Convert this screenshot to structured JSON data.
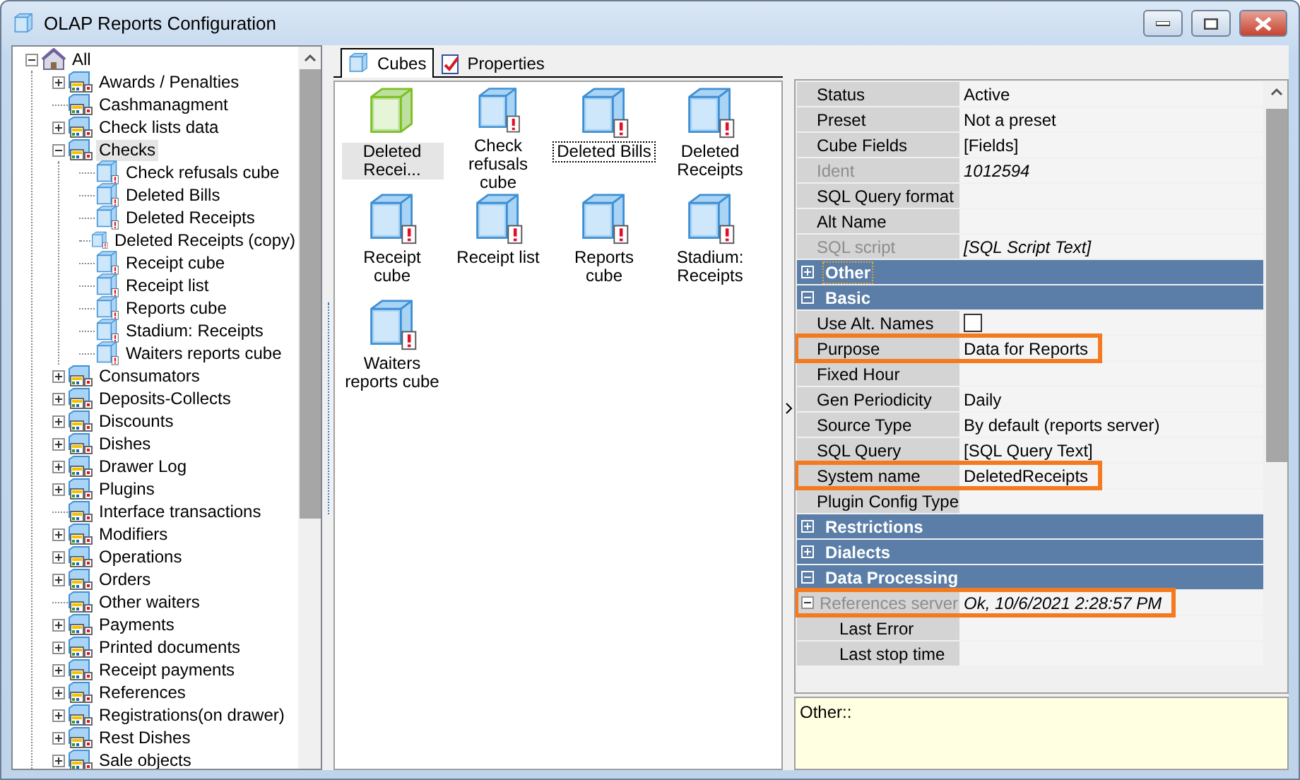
{
  "window": {
    "title": "OLAP Reports Configuration"
  },
  "tree": {
    "label": "All",
    "kind": "root",
    "expanded": true,
    "children": [
      {
        "label": "Awards / Penalties",
        "kind": "folder",
        "expanded": false,
        "selected": false
      },
      {
        "label": "Cashmanagment",
        "kind": "group",
        "selected": false
      },
      {
        "label": "Check lists data",
        "kind": "folder",
        "expanded": false,
        "selected": false
      },
      {
        "label": "Checks",
        "kind": "folder",
        "expanded": true,
        "selected": true,
        "children": [
          {
            "label": "Check refusals cube",
            "kind": "cube",
            "selected": false
          },
          {
            "label": "Deleted Bills",
            "kind": "cube",
            "selected": false
          },
          {
            "label": "Deleted Receipts",
            "kind": "cube",
            "selected": false
          },
          {
            "label": "Deleted Receipts (copy)",
            "kind": "cube",
            "selected": false
          },
          {
            "label": "Receipt cube",
            "kind": "cube",
            "selected": false
          },
          {
            "label": "Receipt list",
            "kind": "cube",
            "selected": false
          },
          {
            "label": "Reports cube",
            "kind": "cube",
            "selected": false
          },
          {
            "label": "Stadium: Receipts",
            "kind": "cube",
            "selected": false
          },
          {
            "label": "Waiters reports cube",
            "kind": "cube",
            "selected": false
          }
        ]
      },
      {
        "label": "Consumators",
        "kind": "folder",
        "expanded": false,
        "selected": false
      },
      {
        "label": "Deposits-Collects",
        "kind": "folder",
        "expanded": false,
        "selected": false
      },
      {
        "label": "Discounts",
        "kind": "folder",
        "expanded": false,
        "selected": false
      },
      {
        "label": "Dishes",
        "kind": "folder",
        "expanded": false,
        "selected": false
      },
      {
        "label": "Drawer Log",
        "kind": "folder",
        "expanded": false,
        "selected": false
      },
      {
        "label": "Plugins",
        "kind": "folder",
        "expanded": false,
        "selected": false
      },
      {
        "label": "Interface transactions",
        "kind": "group",
        "selected": false
      },
      {
        "label": "Modifiers",
        "kind": "folder",
        "expanded": false,
        "selected": false
      },
      {
        "label": "Operations",
        "kind": "folder",
        "expanded": false,
        "selected": false
      },
      {
        "label": "Orders",
        "kind": "folder",
        "expanded": false,
        "selected": false
      },
      {
        "label": "Other waiters",
        "kind": "group",
        "selected": false
      },
      {
        "label": "Payments",
        "kind": "folder",
        "expanded": false,
        "selected": false
      },
      {
        "label": "Printed documents",
        "kind": "folder",
        "expanded": false,
        "selected": false
      },
      {
        "label": "Receipt payments",
        "kind": "folder",
        "expanded": false,
        "selected": false
      },
      {
        "label": "References",
        "kind": "folder",
        "expanded": false,
        "selected": false
      },
      {
        "label": "Registrations(on drawer)",
        "kind": "folder",
        "expanded": false,
        "selected": false
      },
      {
        "label": "Rest Dishes",
        "kind": "folder",
        "expanded": false,
        "selected": false
      },
      {
        "label": "Sale objects",
        "kind": "folder",
        "expanded": false,
        "selected": false
      }
    ]
  },
  "tabs": [
    {
      "label": "Cubes",
      "kind": "cubes",
      "selected": true
    },
    {
      "label": "Properties",
      "kind": "properties",
      "selected": false
    }
  ],
  "cubes": [
    {
      "label": "Deleted Recei...",
      "kind": "active",
      "selected": true,
      "focused": false
    },
    {
      "label": "Check refusals cube",
      "kind": "warning",
      "selected": false,
      "focused": false
    },
    {
      "label": "Deleted Bills",
      "kind": "warning",
      "selected": false,
      "focused": true
    },
    {
      "label": "Deleted Receipts",
      "kind": "warning",
      "selected": false,
      "focused": false
    },
    {
      "label": "Receipt cube",
      "kind": "warning",
      "selected": false,
      "focused": false
    },
    {
      "label": "Receipt list",
      "kind": "warning",
      "selected": false,
      "focused": false
    },
    {
      "label": "Reports cube",
      "kind": "warning",
      "selected": false,
      "focused": false
    },
    {
      "label": "Stadium: Receipts",
      "kind": "warning",
      "selected": false,
      "focused": false
    },
    {
      "label": "Waiters reports cube",
      "kind": "warning",
      "selected": false,
      "focused": false
    }
  ],
  "properties": [
    {
      "kind": "property",
      "name": "Status",
      "value": "Active",
      "readonly": false,
      "highlighted": false
    },
    {
      "kind": "property",
      "name": "Preset",
      "value": "Not a preset",
      "readonly": false,
      "highlighted": false
    },
    {
      "kind": "property",
      "name": "Cube Fields",
      "value": "[Fields]",
      "readonly": false,
      "highlighted": false
    },
    {
      "kind": "property",
      "name": "Ident",
      "value": "1012594",
      "readonly": true,
      "highlighted": false
    },
    {
      "kind": "property",
      "name": "SQL Query format",
      "readonly": false,
      "highlighted": false
    },
    {
      "kind": "property",
      "name": "Alt Name",
      "readonly": false,
      "highlighted": false
    },
    {
      "kind": "property",
      "name": "SQL script",
      "value": "[SQL Script Text]",
      "readonly": true,
      "highlighted": false
    },
    {
      "kind": "category",
      "name": "Other",
      "expanded": false,
      "focused": true
    },
    {
      "kind": "category",
      "name": "Basic",
      "expanded": true,
      "focused": false
    },
    {
      "kind": "checkbox",
      "name": "Use Alt. Names",
      "checked": false,
      "readonly": false,
      "highlighted": false
    },
    {
      "kind": "property",
      "name": "Purpose",
      "value": "Data for Reports",
      "readonly": false,
      "highlighted": true
    },
    {
      "kind": "property",
      "name": "Fixed Hour",
      "readonly": false,
      "highlighted": false
    },
    {
      "kind": "property",
      "name": "Gen Periodicity",
      "value": "Daily",
      "readonly": false,
      "highlighted": false
    },
    {
      "kind": "property",
      "name": "Source Type",
      "value": "By default (reports server)",
      "readonly": false,
      "highlighted": false
    },
    {
      "kind": "property",
      "name": "SQL Query",
      "value": "[SQL Query Text]",
      "readonly": false,
      "highlighted": false
    },
    {
      "kind": "property",
      "name": "System name",
      "value": "DeletedReceipts",
      "readonly": false,
      "highlighted": true
    },
    {
      "kind": "property",
      "name": "Plugin Config Type",
      "readonly": false,
      "highlighted": false
    },
    {
      "kind": "category",
      "name": "Restrictions",
      "expanded": false,
      "focused": false
    },
    {
      "kind": "category",
      "name": "Dialects",
      "expanded": false,
      "focused": false
    },
    {
      "kind": "category",
      "name": "Data Processing",
      "expanded": true,
      "focused": false
    },
    {
      "kind": "parent",
      "name": "References server",
      "value": "Ok, 10/6/2021 2:28:57 PM",
      "readonly": true,
      "highlighted": true,
      "expanded": true,
      "children": [
        {
          "kind": "property",
          "name": "Last Error",
          "readonly": false,
          "highlighted": false
        },
        {
          "kind": "property",
          "name": "Last stop time",
          "readonly": false,
          "highlighted": false
        }
      ]
    }
  ],
  "description": "Other::"
}
